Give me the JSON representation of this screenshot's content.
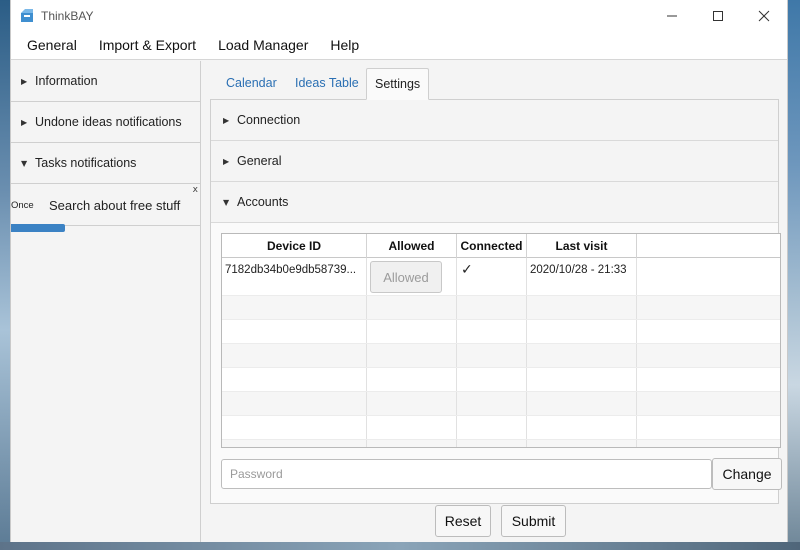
{
  "window": {
    "title": "ThinkBAY",
    "controls": {
      "minimize": "—",
      "maximize": "☐",
      "close": "✕"
    }
  },
  "menu": [
    "General",
    "Import & Export",
    "Load Manager",
    "Help"
  ],
  "sidebar": {
    "sections": [
      {
        "label": "Information",
        "expanded": false,
        "arrow": "▶"
      },
      {
        "label": "Undone ideas notifications",
        "expanded": false,
        "arrow": "▶"
      },
      {
        "label": "Tasks notifications",
        "expanded": true,
        "arrow": "▼"
      }
    ],
    "notification": {
      "frequency": "Once",
      "text": "Search about free stuff",
      "close": "x"
    }
  },
  "tabs": [
    {
      "label": "Calendar",
      "active": false
    },
    {
      "label": "Ideas Table",
      "active": false
    },
    {
      "label": "Settings",
      "active": true
    }
  ],
  "settings": {
    "sections": [
      {
        "label": "Connection",
        "arrow": "▶"
      },
      {
        "label": "General",
        "arrow": "▶"
      },
      {
        "label": "Accounts",
        "arrow": "▼"
      }
    ],
    "accounts_table": {
      "columns": [
        "Device ID",
        "Allowed",
        "Connected",
        "Last visit",
        ""
      ],
      "rows": [
        {
          "device_id": "7182db34b0e9db58739...",
          "allowed_button": "Allowed",
          "connected": "✓",
          "last_visit": "2020/10/28 - 21:33"
        }
      ]
    },
    "password_placeholder": "Password",
    "change_label": "Change"
  },
  "footer": {
    "reset_label": "Reset",
    "submit_label": "Submit"
  },
  "colors": {
    "tab_link": "#2a6fb3",
    "notification_bar": "#3b82c4"
  }
}
